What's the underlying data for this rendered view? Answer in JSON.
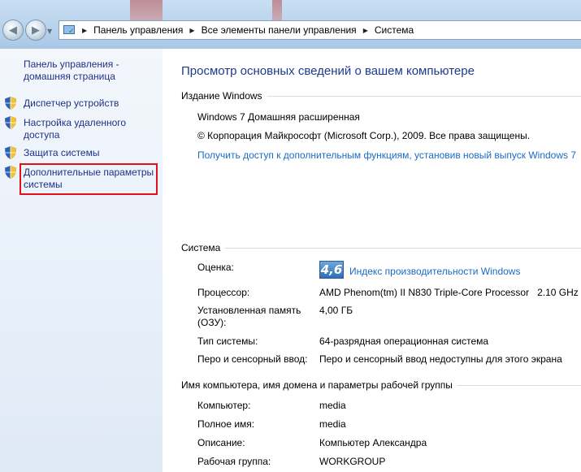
{
  "address_bar": {
    "crumbs": [
      "Панель управления",
      "Все элементы панели управления",
      "Система"
    ]
  },
  "left_pane": {
    "home_link": "Панель управления - домашняя страница",
    "items": [
      {
        "label": "Диспетчер устройств",
        "icon": "uac-shield-icon"
      },
      {
        "label": "Настройка удаленного доступа",
        "icon": "uac-shield-icon"
      },
      {
        "label": "Защита системы",
        "icon": "uac-shield-icon"
      },
      {
        "label": "Дополнительные параметры системы",
        "icon": "uac-shield-icon",
        "highlighted": true
      }
    ],
    "highlight_color": "#e2101a"
  },
  "main": {
    "title": "Просмотр основных сведений о вашем компьютере",
    "edition": {
      "header": "Издание Windows",
      "name": "Windows 7 Домашняя расширенная",
      "copyright": "© Корпорация Майкрософт (Microsoft Corp.), 2009. Все права защищены.",
      "upgrade_link": "Получить доступ к дополнительным функциям, установив новый выпуск Windows 7"
    },
    "system": {
      "header": "Система",
      "rating_label": "Оценка:",
      "rating_score": "4,6",
      "rating_link": "Индекс производительности Windows",
      "cpu_label": "Процессор:",
      "cpu_value": "AMD Phenom(tm) II N830 Triple-Core Processor   2.10 GHz",
      "ram_label": "Установленная память (ОЗУ):",
      "ram_value": "4,00 ГБ",
      "type_label": "Тип системы:",
      "type_value": "64-разрядная операционная система",
      "pen_label": "Перо и сенсорный ввод:",
      "pen_value": "Перо и сенсорный ввод недоступны для этого экрана"
    },
    "computer": {
      "header": "Имя компьютера, имя домена и параметры рабочей группы",
      "computer_label": "Компьютер:",
      "computer_value": "media",
      "fullname_label": "Полное имя:",
      "fullname_value": "media",
      "desc_label": "Описание:",
      "desc_value": "Компьютер Александра",
      "workgroup_label": "Рабочая группа:",
      "workgroup_value": "WORKGROUP"
    }
  },
  "colors": {
    "link": "#1a6bc6",
    "nav_link": "#1e3287",
    "title": "#1e3b8a"
  }
}
